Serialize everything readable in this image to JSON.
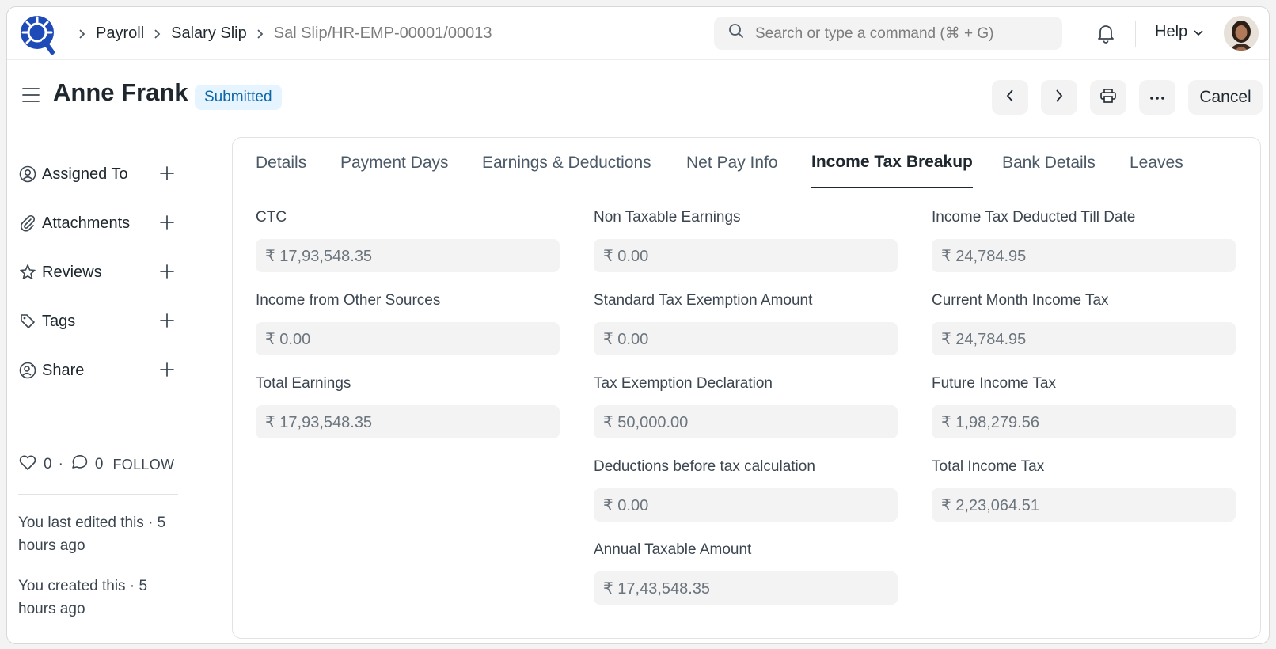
{
  "breadcrumbs": [
    "Payroll",
    "Salary Slip",
    "Sal Slip/HR-EMP-00001/00013"
  ],
  "search": {
    "placeholder": "Search or type a command (⌘ + G)"
  },
  "help_label": "Help",
  "page": {
    "title": "Anne Frank",
    "status": "Submitted",
    "cancel_label": "Cancel"
  },
  "sidebar": {
    "items": [
      {
        "label": "Assigned To",
        "icon": "user-circle-icon"
      },
      {
        "label": "Attachments",
        "icon": "paperclip-icon"
      },
      {
        "label": "Reviews",
        "icon": "star-icon"
      },
      {
        "label": "Tags",
        "icon": "tag-icon"
      },
      {
        "label": "Share",
        "icon": "share-user-icon"
      }
    ],
    "likes": "0",
    "comments": "0",
    "follow_label": "FOLLOW",
    "last_edited": "You last edited this · 5 hours ago",
    "created": "You created this · 5 hours ago"
  },
  "tabs": [
    "Details",
    "Payment Days",
    "Earnings & Deductions",
    "Net Pay Info",
    "Income Tax Breakup",
    "Bank Details",
    "Leaves"
  ],
  "active_tab": "Income Tax Breakup",
  "fields": {
    "col1": [
      {
        "label": "CTC",
        "value": "₹ 17,93,548.35"
      },
      {
        "label": "Income from Other Sources",
        "value": "₹ 0.00"
      },
      {
        "label": "Total Earnings",
        "value": "₹ 17,93,548.35"
      }
    ],
    "col2": [
      {
        "label": "Non Taxable Earnings",
        "value": "₹ 0.00"
      },
      {
        "label": "Standard Tax Exemption Amount",
        "value": "₹ 0.00"
      },
      {
        "label": "Tax Exemption Declaration",
        "value": "₹ 50,000.00"
      },
      {
        "label": "Deductions before tax calculation",
        "value": "₹ 0.00"
      },
      {
        "label": "Annual Taxable Amount",
        "value": "₹ 17,43,548.35"
      }
    ],
    "col3": [
      {
        "label": "Income Tax Deducted Till Date",
        "value": "₹ 24,784.95"
      },
      {
        "label": "Current Month Income Tax",
        "value": "₹ 24,784.95"
      },
      {
        "label": "Future Income Tax",
        "value": "₹ 1,98,279.56"
      },
      {
        "label": "Total Income Tax",
        "value": "₹ 2,23,064.51"
      }
    ]
  },
  "colors": {
    "accent": "#1f272e",
    "badge_bg": "#e6f4ff",
    "badge_text": "#0b66a8",
    "logo": "#1f4bb8"
  }
}
